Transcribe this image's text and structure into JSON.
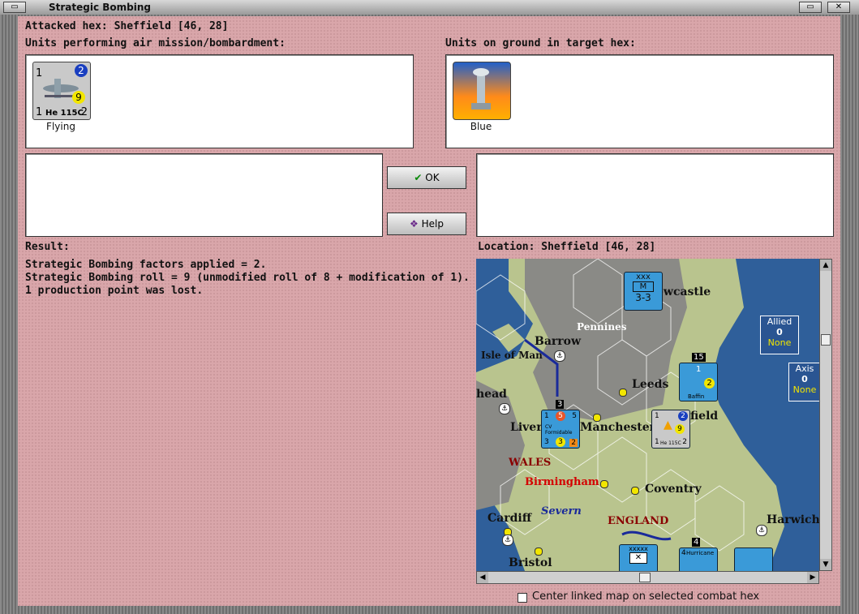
{
  "window": {
    "title": "Strategic Bombing"
  },
  "attacked_hex": "Attacked hex: Sheffield  [46, 28]",
  "air_units": {
    "label": "Units performing air mission/bombardment:",
    "unit": {
      "name": "He 115C",
      "status": "Flying",
      "top_left": "1",
      "top_right": "2",
      "bottom_left": "1",
      "bottom_right": "2",
      "bombing": "9"
    }
  },
  "ground_units": {
    "label": "Units on ground in target hex:",
    "unit": {
      "status": "Blue"
    }
  },
  "buttons": {
    "ok": "OK",
    "help": "Help"
  },
  "result": {
    "label": "Result:",
    "lines": [
      "Strategic Bombing factors applied = 2.",
      "Strategic Bombing roll = 9 (unmodified roll of 8 + modification of 1).",
      "1 production point was lost."
    ]
  },
  "location": {
    "label": "Location:  Sheffield  [46, 28]"
  },
  "map": {
    "places": [
      "ewcastle",
      "Pennines",
      "Barrow",
      "Isle of Man",
      "Leeds",
      "head",
      "Liver",
      "Manchester",
      "field",
      "WALES",
      "Birmingham",
      "Coventry",
      "Cardiff",
      "Severn",
      "ENGLAND",
      "Harwich",
      "Bristol"
    ],
    "allied": {
      "label": "Allied",
      "value": "0",
      "sub": "None"
    },
    "axis": {
      "label": "Axis",
      "value": "0",
      "sub": "None"
    },
    "stack_counts": [
      "15",
      "3",
      "4"
    ],
    "counters": {
      "corps": {
        "size": "xxx",
        "type": "M",
        "strength": "3-3"
      },
      "ship": {
        "name": "Baffin",
        "top": "1",
        "bombard": "2"
      },
      "carrier": {
        "name": "CV Formidable",
        "tl": "1",
        "tm": "5",
        "tr": "5",
        "bl": "3",
        "bm": "3",
        "br": "2"
      },
      "bomber": {
        "name": "He 115C",
        "tl": "1",
        "tr": "2",
        "bl": "1",
        "br": "2",
        "b": "9"
      },
      "bottom": {
        "army": "xxxxx",
        "fighter": "Hurricane",
        "fighter_top": "4"
      }
    }
  },
  "center_checkbox": {
    "label": "Center linked map on selected combat hex",
    "checked": false
  },
  "colors": {
    "panel": "#d9a6aa",
    "map_sea": "#2f5f9a",
    "map_land": "#b9c48e",
    "counter_blue": "#3a9ad8"
  }
}
